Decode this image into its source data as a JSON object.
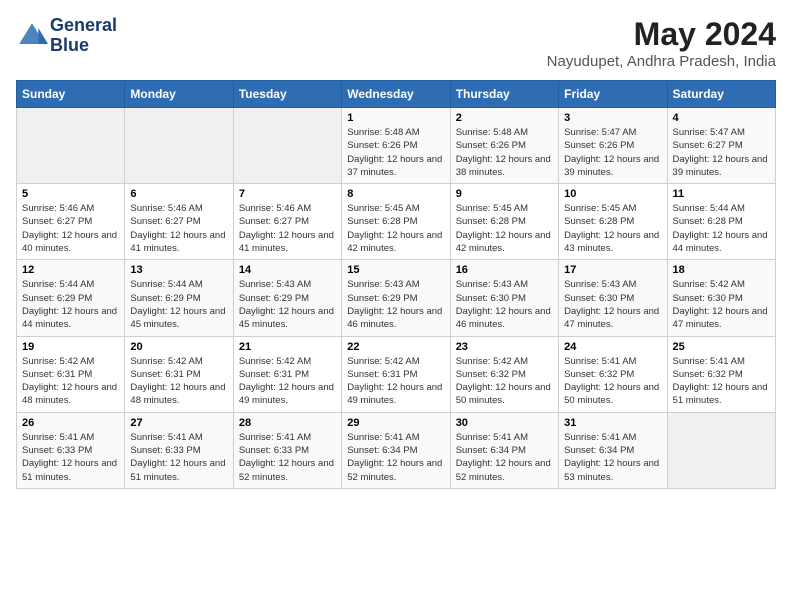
{
  "header": {
    "logo_line1": "General",
    "logo_line2": "Blue",
    "title": "May 2024",
    "subtitle": "Nayudupet, Andhra Pradesh, India"
  },
  "days_of_week": [
    "Sunday",
    "Monday",
    "Tuesday",
    "Wednesday",
    "Thursday",
    "Friday",
    "Saturday"
  ],
  "weeks": [
    [
      {
        "day": "",
        "info": ""
      },
      {
        "day": "",
        "info": ""
      },
      {
        "day": "",
        "info": ""
      },
      {
        "day": "1",
        "info": "Sunrise: 5:48 AM\nSunset: 6:26 PM\nDaylight: 12 hours and 37 minutes."
      },
      {
        "day": "2",
        "info": "Sunrise: 5:48 AM\nSunset: 6:26 PM\nDaylight: 12 hours and 38 minutes."
      },
      {
        "day": "3",
        "info": "Sunrise: 5:47 AM\nSunset: 6:26 PM\nDaylight: 12 hours and 39 minutes."
      },
      {
        "day": "4",
        "info": "Sunrise: 5:47 AM\nSunset: 6:27 PM\nDaylight: 12 hours and 39 minutes."
      }
    ],
    [
      {
        "day": "5",
        "info": "Sunrise: 5:46 AM\nSunset: 6:27 PM\nDaylight: 12 hours and 40 minutes."
      },
      {
        "day": "6",
        "info": "Sunrise: 5:46 AM\nSunset: 6:27 PM\nDaylight: 12 hours and 41 minutes."
      },
      {
        "day": "7",
        "info": "Sunrise: 5:46 AM\nSunset: 6:27 PM\nDaylight: 12 hours and 41 minutes."
      },
      {
        "day": "8",
        "info": "Sunrise: 5:45 AM\nSunset: 6:28 PM\nDaylight: 12 hours and 42 minutes."
      },
      {
        "day": "9",
        "info": "Sunrise: 5:45 AM\nSunset: 6:28 PM\nDaylight: 12 hours and 42 minutes."
      },
      {
        "day": "10",
        "info": "Sunrise: 5:45 AM\nSunset: 6:28 PM\nDaylight: 12 hours and 43 minutes."
      },
      {
        "day": "11",
        "info": "Sunrise: 5:44 AM\nSunset: 6:28 PM\nDaylight: 12 hours and 44 minutes."
      }
    ],
    [
      {
        "day": "12",
        "info": "Sunrise: 5:44 AM\nSunset: 6:29 PM\nDaylight: 12 hours and 44 minutes."
      },
      {
        "day": "13",
        "info": "Sunrise: 5:44 AM\nSunset: 6:29 PM\nDaylight: 12 hours and 45 minutes."
      },
      {
        "day": "14",
        "info": "Sunrise: 5:43 AM\nSunset: 6:29 PM\nDaylight: 12 hours and 45 minutes."
      },
      {
        "day": "15",
        "info": "Sunrise: 5:43 AM\nSunset: 6:29 PM\nDaylight: 12 hours and 46 minutes."
      },
      {
        "day": "16",
        "info": "Sunrise: 5:43 AM\nSunset: 6:30 PM\nDaylight: 12 hours and 46 minutes."
      },
      {
        "day": "17",
        "info": "Sunrise: 5:43 AM\nSunset: 6:30 PM\nDaylight: 12 hours and 47 minutes."
      },
      {
        "day": "18",
        "info": "Sunrise: 5:42 AM\nSunset: 6:30 PM\nDaylight: 12 hours and 47 minutes."
      }
    ],
    [
      {
        "day": "19",
        "info": "Sunrise: 5:42 AM\nSunset: 6:31 PM\nDaylight: 12 hours and 48 minutes."
      },
      {
        "day": "20",
        "info": "Sunrise: 5:42 AM\nSunset: 6:31 PM\nDaylight: 12 hours and 48 minutes."
      },
      {
        "day": "21",
        "info": "Sunrise: 5:42 AM\nSunset: 6:31 PM\nDaylight: 12 hours and 49 minutes."
      },
      {
        "day": "22",
        "info": "Sunrise: 5:42 AM\nSunset: 6:31 PM\nDaylight: 12 hours and 49 minutes."
      },
      {
        "day": "23",
        "info": "Sunrise: 5:42 AM\nSunset: 6:32 PM\nDaylight: 12 hours and 50 minutes."
      },
      {
        "day": "24",
        "info": "Sunrise: 5:41 AM\nSunset: 6:32 PM\nDaylight: 12 hours and 50 minutes."
      },
      {
        "day": "25",
        "info": "Sunrise: 5:41 AM\nSunset: 6:32 PM\nDaylight: 12 hours and 51 minutes."
      }
    ],
    [
      {
        "day": "26",
        "info": "Sunrise: 5:41 AM\nSunset: 6:33 PM\nDaylight: 12 hours and 51 minutes."
      },
      {
        "day": "27",
        "info": "Sunrise: 5:41 AM\nSunset: 6:33 PM\nDaylight: 12 hours and 51 minutes."
      },
      {
        "day": "28",
        "info": "Sunrise: 5:41 AM\nSunset: 6:33 PM\nDaylight: 12 hours and 52 minutes."
      },
      {
        "day": "29",
        "info": "Sunrise: 5:41 AM\nSunset: 6:34 PM\nDaylight: 12 hours and 52 minutes."
      },
      {
        "day": "30",
        "info": "Sunrise: 5:41 AM\nSunset: 6:34 PM\nDaylight: 12 hours and 52 minutes."
      },
      {
        "day": "31",
        "info": "Sunrise: 5:41 AM\nSunset: 6:34 PM\nDaylight: 12 hours and 53 minutes."
      },
      {
        "day": "",
        "info": ""
      }
    ]
  ]
}
